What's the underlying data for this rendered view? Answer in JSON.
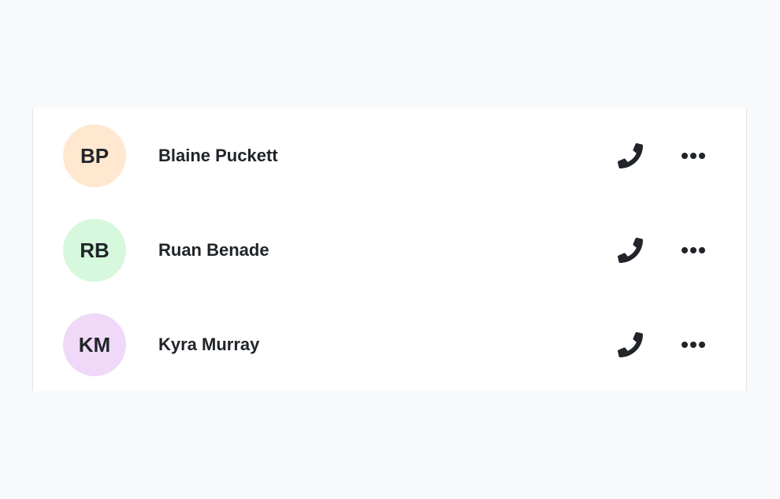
{
  "contacts": [
    {
      "initials": "BP",
      "name": "Blaine Puckett",
      "avatar_color": "#ffe8cf",
      "call_icon": "phone-icon",
      "more_icon": "ellipsis-icon"
    },
    {
      "initials": "RB",
      "name": "Ruan Benade",
      "avatar_color": "#d6f8dc",
      "call_icon": "phone-icon",
      "more_icon": "ellipsis-icon"
    },
    {
      "initials": "KM",
      "name": "Kyra Murray",
      "avatar_color": "#f0d9f8",
      "call_icon": "phone-icon",
      "more_icon": "ellipsis-icon"
    }
  ],
  "colors": {
    "page_background": "#f8f9fb",
    "card_background": "#ffffff",
    "text": "#212529"
  }
}
